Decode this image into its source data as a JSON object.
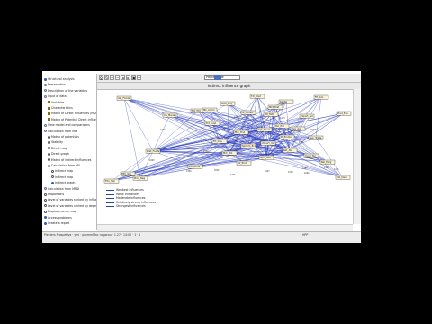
{
  "window": {
    "title": "MICMAC"
  },
  "toolbar": {
    "buttons": [
      {
        "name": "print-icon",
        "glyph": "⎙"
      },
      {
        "name": "refresh-icon",
        "glyph": "↻"
      },
      {
        "name": "zoom-in-icon",
        "glyph": "+"
      },
      {
        "name": "zoom-out-icon",
        "glyph": "−"
      },
      {
        "name": "arrow-left-icon",
        "glyph": "◂"
      },
      {
        "name": "arrow-right-icon",
        "glyph": "▸"
      },
      {
        "name": "fit-icon",
        "glyph": "▣"
      },
      {
        "name": "select-icon",
        "glyph": "⌖"
      }
    ],
    "zoom_label": "Percentage"
  },
  "sidebar": {
    "items": [
      {
        "label": "Structural analysis",
        "level": 0,
        "icon": "b"
      },
      {
        "label": "Presentation",
        "level": 0,
        "icon": "c"
      },
      {
        "label": "Description of the variables",
        "level": 0,
        "icon": "c"
      },
      {
        "label": "Input of data",
        "level": 0,
        "icon": "c"
      },
      {
        "label": "Variables",
        "level": 1,
        "icon": "s"
      },
      {
        "label": "Characteristics",
        "level": 1,
        "icon": "s"
      },
      {
        "label": "Matrix of Direct Influences (MDI)",
        "level": 1,
        "icon": "s"
      },
      {
        "label": "Matrix of Potential Direct Influences",
        "level": 1,
        "icon": "s"
      },
      {
        "label": "View model and comparisons",
        "level": 0,
        "icon": "c"
      },
      {
        "label": "Calculation from MDI",
        "level": 0,
        "icon": "c"
      },
      {
        "label": "Matrix of potentials",
        "level": 1,
        "icon": "m"
      },
      {
        "label": "Stability",
        "level": 1,
        "icon": "m"
      },
      {
        "label": "Direct map",
        "level": 1,
        "icon": "m"
      },
      {
        "label": "Direct graph",
        "level": 1,
        "icon": "m"
      },
      {
        "label": "Matrix of indirect influences",
        "level": 1,
        "icon": "m"
      },
      {
        "label": "Calculation from MII",
        "level": 1,
        "icon": "c"
      },
      {
        "label": "Indirect map",
        "level": 2,
        "icon": "m"
      },
      {
        "label": "Indirect map",
        "level": 2,
        "icon": "m"
      },
      {
        "label": "Indirect graph",
        "level": 2,
        "icon": "b"
      },
      {
        "label": "Calculation from MPDI",
        "level": 0,
        "icon": "c"
      },
      {
        "label": "Proportions",
        "level": 0,
        "icon": "m"
      },
      {
        "label": "Level of variables ranked by influence",
        "level": 0,
        "icon": "m"
      },
      {
        "label": "Level of variables ranked by dependence",
        "level": 0,
        "icon": "m"
      },
      {
        "label": "Displacements map",
        "level": 0,
        "icon": "m"
      },
      {
        "label": "Access problems",
        "level": 0,
        "icon": "b"
      },
      {
        "label": "Create a report",
        "level": 0,
        "icon": "b"
      }
    ]
  },
  "graph": {
    "title": "Indirect influence graph",
    "nodes": [
      {
        "id": "n1",
        "label": "Vet_Foods"
      },
      {
        "id": "n2",
        "label": "Ins_Manag"
      },
      {
        "id": "n3",
        "label": "Fbt_Ifld"
      },
      {
        "id": "n4",
        "label": "Mult_Acq"
      },
      {
        "id": "n5",
        "label": "Tm_Diet"
      },
      {
        "id": "n6",
        "label": "Kaptw"
      },
      {
        "id": "n7",
        "label": "Frt_Gro"
      },
      {
        "id": "n8",
        "label": "Prod_Exs"
      },
      {
        "id": "n9",
        "label": "Mk_Anmn"
      },
      {
        "id": "n10",
        "label": "Sl_Consol"
      },
      {
        "id": "n11",
        "label": "Rtl_Tadh"
      },
      {
        "id": "n12",
        "label": "Export_Am"
      },
      {
        "id": "n13",
        "label": "Diet_Foods"
      },
      {
        "id": "n14",
        "label": "Sprmm_Eco"
      },
      {
        "id": "n15",
        "label": "Import_ms"
      },
      {
        "id": "n16",
        "label": "Pl_Produc"
      },
      {
        "id": "n17",
        "label": "Sup_Trade"
      },
      {
        "id": "n18",
        "label": "Mrk_Frst"
      },
      {
        "id": "n19",
        "label": "Cpt_Devel"
      },
      {
        "id": "n20",
        "label": "Tec_Pnt"
      },
      {
        "id": "n21",
        "label": "Dev_Ag"
      },
      {
        "id": "n22",
        "label": "Frt_Ops"
      },
      {
        "id": "n23",
        "label": "Mrk_Pnt"
      },
      {
        "id": "n24",
        "label": "Smh_Mrk"
      },
      {
        "id": "n25",
        "label": "Ret_Atn"
      },
      {
        "id": "n26",
        "label": "Invnt_Tec"
      },
      {
        "id": "n27",
        "label": "Pm_Atms"
      },
      {
        "id": "n28",
        "label": "Inf_Prod"
      },
      {
        "id": "n29",
        "label": "Rel_Enrg"
      },
      {
        "id": "n30",
        "label": "Prod_Reg"
      },
      {
        "id": "n31",
        "label": "Pfm_Gro"
      },
      {
        "id": "n32",
        "label": "Fdn_Sqn"
      },
      {
        "id": "n33",
        "label": "Ext_Dem"
      },
      {
        "id": "n34",
        "label": "Trd_Cust"
      },
      {
        "id": "n35",
        "label": "Mkt_Dist"
      }
    ],
    "edge_labels": [
      "1663",
      "1505",
      "1505",
      "1550",
      "1713",
      "1652",
      "1607",
      "1539",
      "1483",
      "1459",
      "1475",
      "1469",
      "1483",
      "1459",
      "1550",
      "1664",
      "1475"
    ],
    "legend": [
      "Weakest influences",
      "Weak influences",
      "Moderate influences",
      "Relatively strong influences",
      "Strongest influences"
    ]
  },
  "status": {
    "left": "Pleniers Prospetiva · yml · pcvmmMac nogorau · 1.27 · 14:00 · 1 · 1",
    "right": "HPP"
  },
  "colors": {
    "edge": "#2c3fbf",
    "node_fill": "#fbf3d7",
    "accent": "#4f6fc4"
  }
}
